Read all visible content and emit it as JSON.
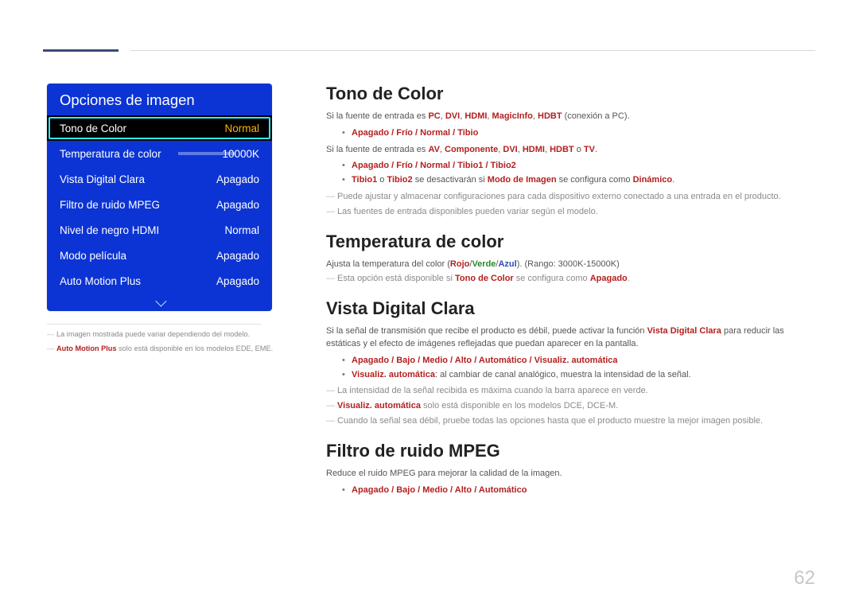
{
  "page_number": "62",
  "menu": {
    "title": "Opciones de imagen",
    "items": [
      {
        "label": "Tono de Color",
        "value": "Normal",
        "active": true
      },
      {
        "label": "Temperatura de color",
        "value": "10000K",
        "slider": true
      },
      {
        "label": "Vista Digital Clara",
        "value": "Apagado"
      },
      {
        "label": "Filtro de ruido MPEG",
        "value": "Apagado"
      },
      {
        "label": "Nivel de negro HDMI",
        "value": "Normal"
      },
      {
        "label": "Modo película",
        "value": "Apagado"
      },
      {
        "label": "Auto Motion Plus",
        "value": "Apagado"
      }
    ],
    "footnote1_a": "La imagen mostrada puede variar dependiendo del modelo.",
    "footnote2_a": "Auto Motion Plus",
    "footnote2_b": " solo está disponible en los modelos EDE, EME."
  },
  "sec1": {
    "title": "Tono de Color",
    "p1a": "Si la fuente de entrada es ",
    "p1b": "PC",
    "p1c": ", ",
    "p1d": "DVI",
    "p1e": ", ",
    "p1f": "HDMI",
    "p1g": ", ",
    "p1h": "MagicInfo",
    "p1i": ", ",
    "p1j": "HDBT",
    "p1k": " (conexión a PC).",
    "opt1": "Apagado / Frío / Normal / Tibio",
    "p2a": "Si la fuente de entrada es ",
    "p2b": "AV",
    "p2c": ", ",
    "p2d": "Componente",
    "p2e": ", ",
    "p2f": "DVI",
    "p2g": ", ",
    "p2h": "HDMI",
    "p2i": ", ",
    "p2j": "HDBT",
    "p2k": " o ",
    "p2l": "TV",
    "p2m": ".",
    "opt2": "Apagado / Frío / Normal / Tibio1 / Tibio2",
    "bul3a": "Tibio1",
    "bul3b": " o ",
    "bul3c": "Tibio2",
    "bul3d": " se desactivarán si ",
    "bul3e": "Modo de Imagen",
    "bul3f": " se configura como ",
    "bul3g": "Dinámico",
    "bul3h": ".",
    "d1": "Puede ajustar y almacenar configuraciones para cada dispositivo externo conectado a una entrada en el producto.",
    "d2": "Las fuentes de entrada disponibles pueden variar según el modelo."
  },
  "sec2": {
    "title": "Temperatura de color",
    "p1a": "Ajusta la temperatura del color (",
    "p1b": "Rojo",
    "p1c": "/",
    "p1d": "Verde",
    "p1e": "/",
    "p1f": "Azul",
    "p1g": "). (Rango: 3000K-15000K)",
    "d1a": "Esta opción está disponible si ",
    "d1b": "Tono de Color",
    "d1c": " se configura como ",
    "d1d": "Apagado",
    "d1e": "."
  },
  "sec3": {
    "title": "Vista Digital Clara",
    "p1a": "Si la señal de transmisión que recibe el producto es débil, puede activar la función ",
    "p1b": "Vista Digital Clara",
    "p1c": " para reducir las estáticas y el efecto de imágenes reflejadas que puedan aparecer en la pantalla.",
    "opt1": "Apagado / Bajo / Medio / Alto / Automático / Visualiz. automática",
    "bul2a": "Visualiz. automática",
    "bul2b": ": al cambiar de canal analógico, muestra la intensidad de la señal.",
    "d1": "La intensidad de la señal recibida es máxima cuando la barra aparece en verde.",
    "d2a": "Visualiz. automática",
    "d2b": " solo está disponible en los modelos DCE, DCE-M.",
    "d3": "Cuando la señal sea débil, pruebe todas las opciones hasta que el producto muestre la mejor imagen posible."
  },
  "sec4": {
    "title": "Filtro de ruido MPEG",
    "p1": "Reduce el ruido MPEG para mejorar la calidad de la imagen.",
    "opt1": "Apagado / Bajo / Medio / Alto / Automático"
  }
}
